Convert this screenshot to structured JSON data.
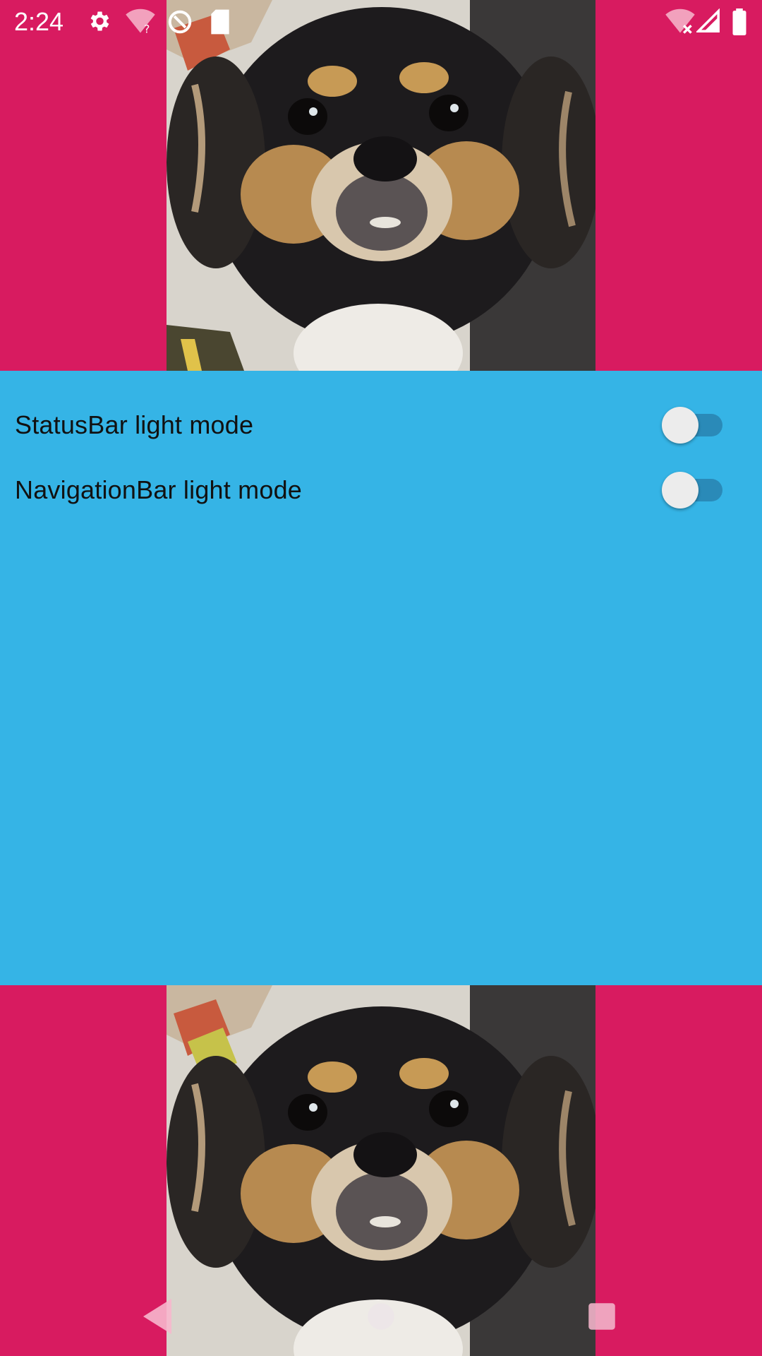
{
  "status_bar": {
    "time": "2:24",
    "icons": [
      "gear-icon",
      "wifi-question-icon",
      "sync-circle-icon",
      "sd-card-icon",
      "wifi-off-icon",
      "cell-signal-icon",
      "battery-icon"
    ]
  },
  "images": {
    "top": "dog-photo",
    "bottom": "dog-photo"
  },
  "settings": [
    {
      "label": "StatusBar light mode",
      "enabled": false
    },
    {
      "label": "NavigationBar light mode",
      "enabled": false
    }
  ],
  "colors": {
    "background": "#d81b60",
    "panel": "#35b4e6",
    "switch_track": "#2a8ab8",
    "switch_thumb": "#ececec"
  },
  "nav_bar": {
    "buttons": [
      "back-icon",
      "home-icon",
      "recents-icon"
    ]
  }
}
